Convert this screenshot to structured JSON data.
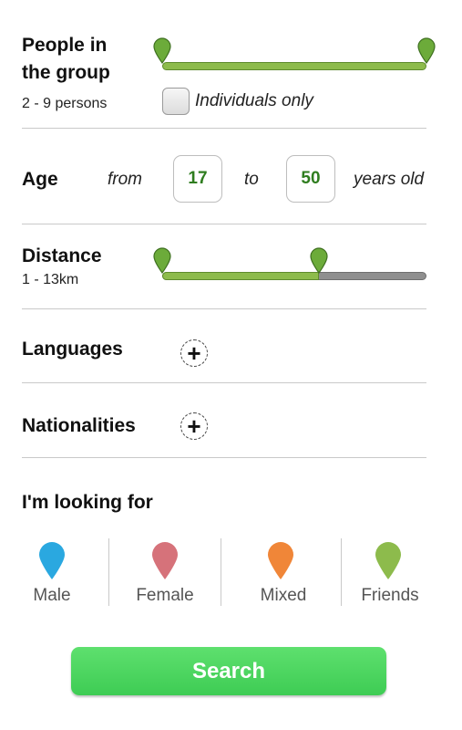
{
  "group": {
    "title_line1": "People in",
    "title_line2": "the group",
    "range": "2 - 9 persons",
    "range_min": 2,
    "range_max": 9,
    "individuals_label": "Individuals only",
    "individuals_checked": false
  },
  "age": {
    "title": "Age",
    "from_label": "from",
    "from_value": "17",
    "to_label": "to",
    "to_value": "50",
    "suffix": "years old"
  },
  "distance": {
    "title": "Distance",
    "range": "1 - 13km",
    "range_min_km": 1,
    "range_max_km": 13
  },
  "languages": {
    "title": "Languages"
  },
  "nationalities": {
    "title": "Nationalities"
  },
  "looking_for": {
    "title": "I'm looking for",
    "options": [
      {
        "label": "Male",
        "color": "#2aa8e0"
      },
      {
        "label": "Female",
        "color": "#d6727a"
      },
      {
        "label": "Mixed",
        "color": "#f08638"
      },
      {
        "label": "Friends",
        "color": "#8dbb4c"
      }
    ]
  },
  "search_label": "Search",
  "colors": {
    "accent_green": "#8dbb4c",
    "button_green": "#4ad762",
    "number_green": "#2f7d1f"
  }
}
